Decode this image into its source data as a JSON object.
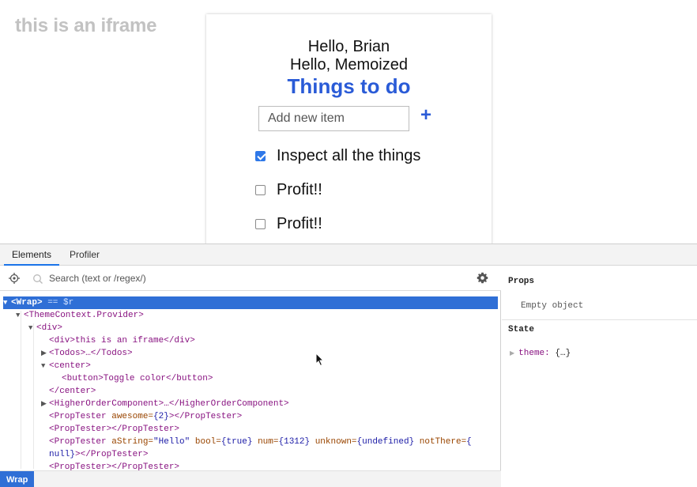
{
  "app": {
    "iframe_label": "this is an iframe",
    "greeting_1": "Hello, Brian",
    "greeting_2": "Hello, Memoized",
    "title": "Things to do",
    "add_placeholder": "Add new item",
    "add_button": "+",
    "todos": [
      {
        "label": "Inspect all the things",
        "checked": true
      },
      {
        "label": "Profit!!",
        "checked": false
      },
      {
        "label": "Profit!!",
        "checked": false
      }
    ]
  },
  "devtools": {
    "tabs": [
      "Elements",
      "Profiler"
    ],
    "active_tab": "Elements",
    "search_placeholder": "Search (text or /regex/)",
    "tree": {
      "r0_tag": "<Wrap>",
      "r0_ref": " == $r",
      "r1": "<ThemeContext.Provider>",
      "r2": "<div>",
      "r3": "<div>this is an iframe</div>",
      "r4": "<Todos>…</Todos>",
      "r5": "<center>",
      "r6": "<button>Toggle color</button>",
      "r7": "</center>",
      "r8": "<HigherOrderComponent>…</HigherOrderComponent>",
      "r9_open": "<PropTester",
      "r9_attr": " awesome=",
      "r9_val": "{2}",
      "r9_close": "></PropTester>",
      "r10": "<PropTester></PropTester>",
      "r11_open": "<PropTester",
      "r11_a1": " aString=",
      "r11_v1": "\"Hello\"",
      "r11_a2": " bool=",
      "r11_v2": "{true}",
      "r11_a3": " num=",
      "r11_v3": "{1312}",
      "r11_a4": " unknown=",
      "r11_v4": "{undefined}",
      "r11_a5": " notThere=",
      "r11_v5": "{",
      "r12_val": "null}",
      "r12_close": "></PropTester>",
      "r13": "<PropTester></PropTester>"
    },
    "breadcrumb": "Wrap",
    "props_title": "Props",
    "props_empty": "Empty object",
    "state_title": "State",
    "state_key": "theme:",
    "state_value": "{…}"
  },
  "colors": {
    "accent": "#2a5bd7",
    "selection": "#2f6fd6"
  }
}
